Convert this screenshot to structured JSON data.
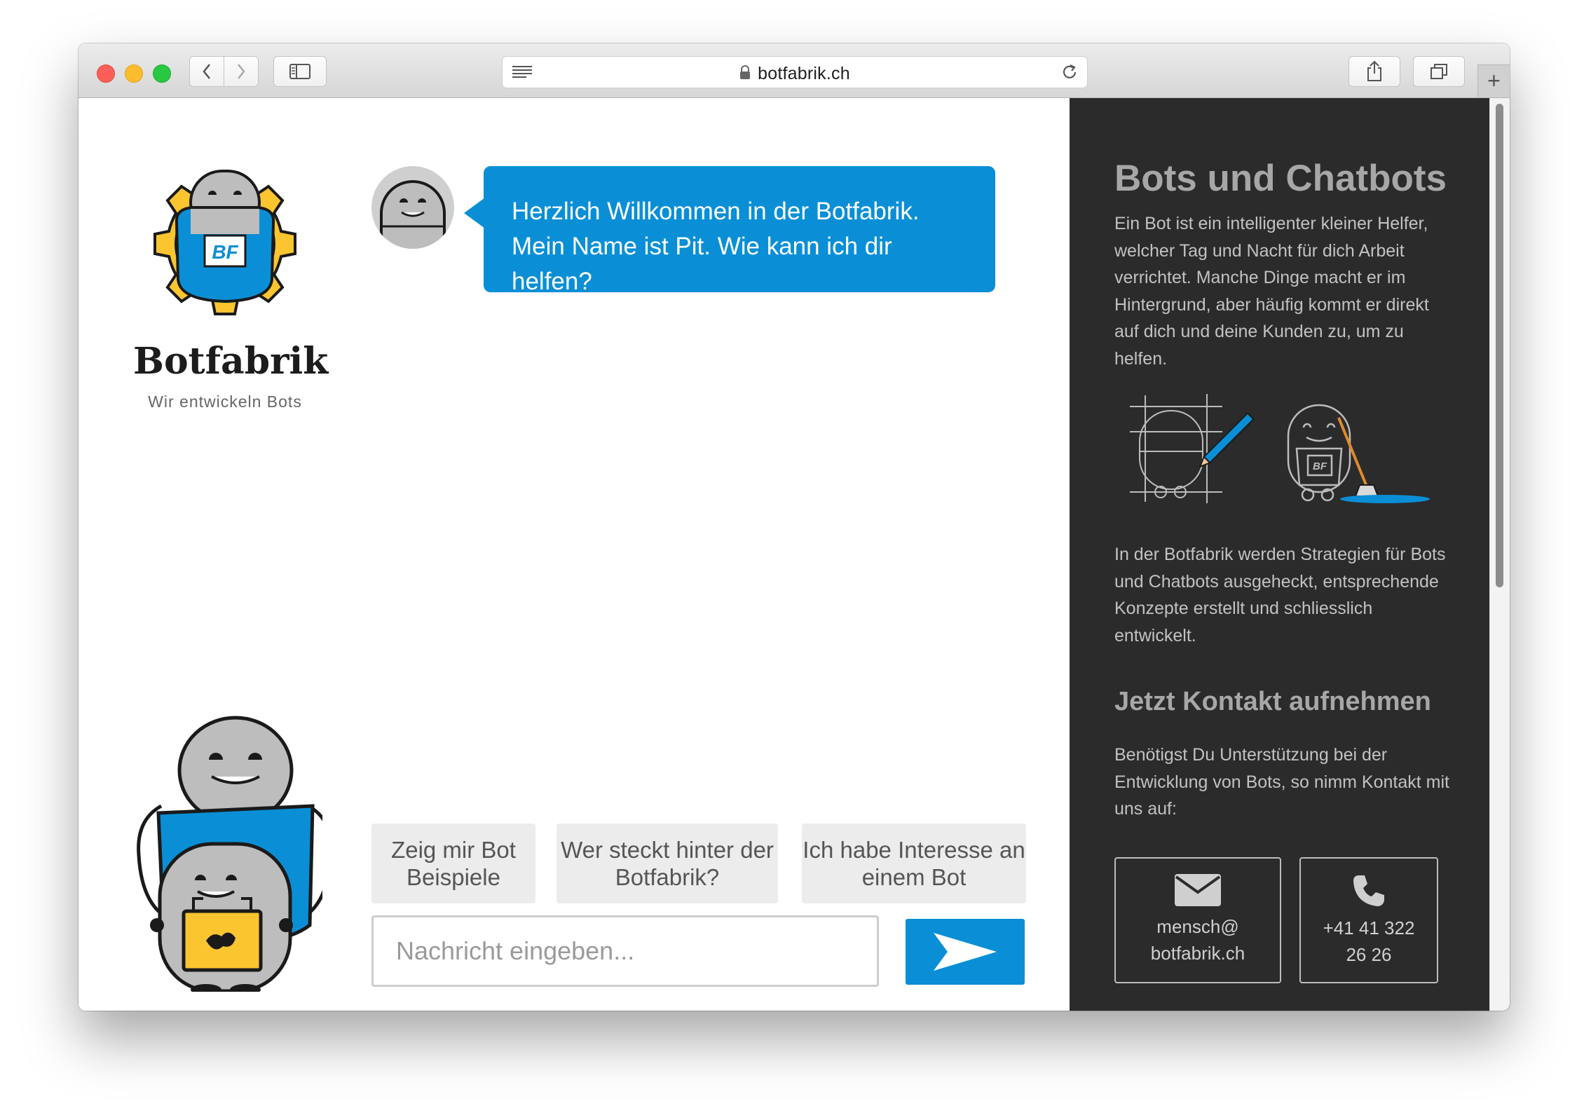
{
  "browser": {
    "url": "botfabrik.ch"
  },
  "brand": {
    "name": "Botfabrik",
    "tagline": "Wir entwickeln Bots",
    "badge": "BF",
    "colors": {
      "accent": "#0a8fd6",
      "gear": "#fbc530",
      "sidebar": "#2b2b2b"
    }
  },
  "chat": {
    "welcome": "Herzlich Willkommen in der Botfabrik. Mein Name ist Pit. Wie kann ich dir helfen?",
    "quick_replies": [
      "Zeig mir Bot Beispiele",
      "Wer steckt hinter der Botfabrik?",
      "Ich habe Interesse an einem Bot"
    ],
    "input_placeholder": "Nachricht eingeben...",
    "send_icon": "send-arrow-icon"
  },
  "sidebar": {
    "title": "Bots und Chatbots",
    "intro": "Ein Bot ist ein intelligenter kleiner Helfer, welcher Tag und Nacht für dich Arbeit verrichtet. Manche Dinge macht er im Hintergrund, aber häufig kommt er direkt auf dich und deine Kunden zu, um zu helfen.",
    "strategy": "In der Botfabrik werden Strategien für Bots und Chatbots ausgeheckt, entsprechende Konzepte erstellt und schliesslich entwickelt.",
    "contact_title": "Jetzt Kontakt aufnehmen",
    "contact_text": "Benötigst Du Unterstützung bei der Entwicklung von Bots, so nimm Kontakt mit uns auf:",
    "email_line1": "mensch@",
    "email_line2": "botfabrik.ch",
    "phone_line1": "+41 41 322",
    "phone_line2": "26 26"
  }
}
